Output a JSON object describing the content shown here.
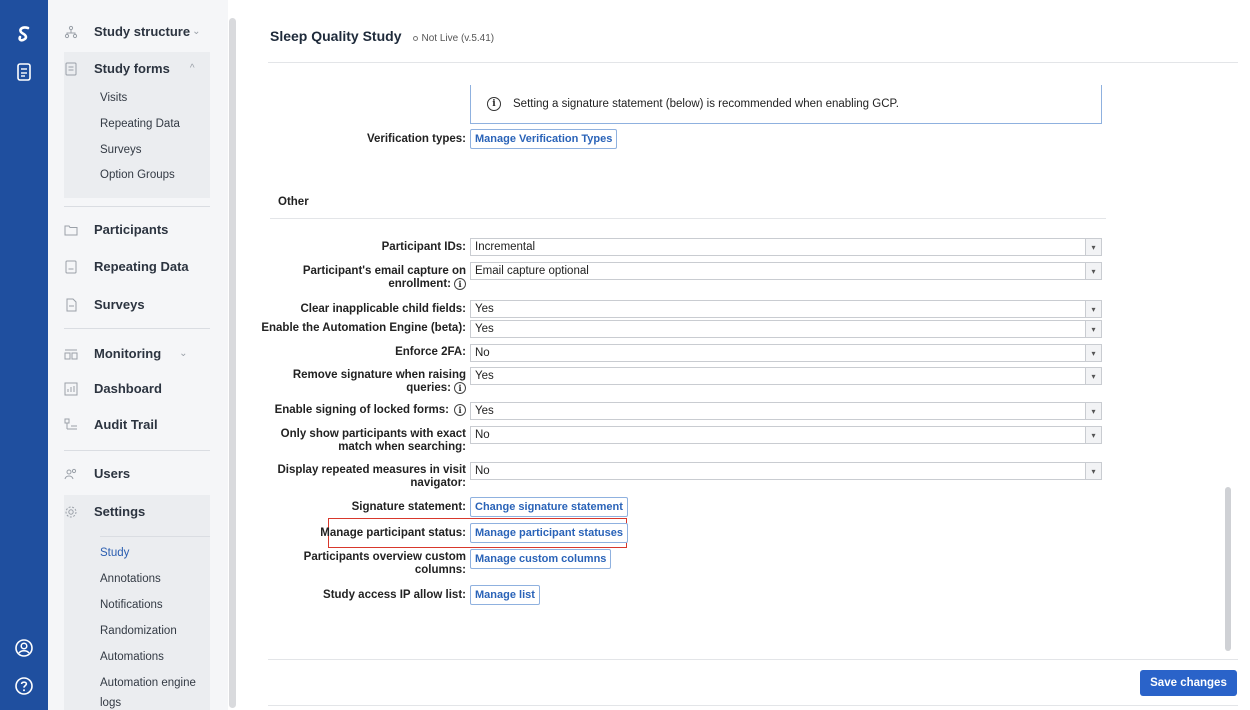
{
  "sidebar": {
    "study_structure": "Study structure",
    "study_forms": "Study forms",
    "forms_items": [
      "Visits",
      "Repeating Data",
      "Surveys",
      "Option Groups"
    ],
    "participants": "Participants",
    "repeating_data": "Repeating Data",
    "surveys": "Surveys",
    "monitoring": "Monitoring",
    "dashboard": "Dashboard",
    "audit_trail": "Audit Trail",
    "users": "Users",
    "settings": "Settings",
    "settings_items": [
      "Study",
      "Annotations",
      "Notifications",
      "Randomization",
      "Automations",
      "Automation engine",
      "logs"
    ]
  },
  "header": {
    "title": "Sleep Quality Study",
    "status": "Not Live (v.5.41)"
  },
  "gcp_note": "Setting a signature statement (below) is recommended when enabling GCP.",
  "verification": {
    "label": "Verification types:",
    "button": "Manage Verification Types"
  },
  "other_title": "Other",
  "selects": {
    "participant_ids": {
      "l1": "Participant IDs:",
      "value": "Incremental"
    },
    "email_capture": {
      "l1": "Participant's email capture on",
      "l2": "enrollment:",
      "value": "Email capture optional"
    },
    "clear_fields": {
      "l1": "Clear inapplicable child fields:",
      "value": "Yes"
    },
    "automation": {
      "l1": "Enable the Automation Engine (beta):",
      "value": "Yes"
    },
    "enforce_2fa": {
      "l1": "Enforce 2FA:",
      "value": "No"
    },
    "remove_sig": {
      "l1": "Remove signature when raising",
      "l2": "queries:",
      "value": "Yes"
    },
    "locked_signing": {
      "l1": "Enable signing of locked forms:",
      "value": "Yes"
    },
    "exact_match": {
      "l1": "Only show participants with exact",
      "l2": "match when searching:",
      "value": "No"
    },
    "repeated_measures": {
      "l1": "Display repeated measures in visit",
      "l2": "navigator:",
      "value": "No"
    }
  },
  "buttons": {
    "signature": {
      "label": "Signature statement:",
      "button": "Change signature statement"
    },
    "status": {
      "label": "Manage participant status:",
      "button": "Manage participant statuses"
    },
    "columns": {
      "l1": "Participants overview custom",
      "l2": "columns:",
      "button": "Manage custom columns"
    },
    "ip_list": {
      "label": "Study access IP allow list:",
      "button": "Manage list"
    }
  },
  "save_label": "Save changes",
  "colors": {
    "rail": "#1f4f9f",
    "accent": "#2a63c9",
    "highlight": "#d8382c"
  }
}
